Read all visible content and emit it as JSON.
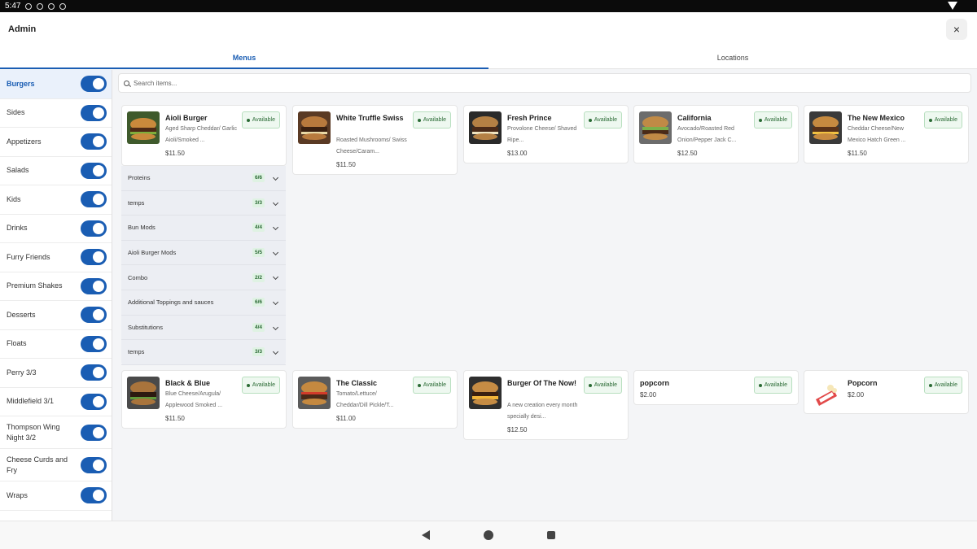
{
  "status": {
    "time": "5:47"
  },
  "app": {
    "title": "Admin",
    "close_label": "×"
  },
  "tabs": [
    {
      "label": "Menus",
      "active": true
    },
    {
      "label": "Locations",
      "active": false
    }
  ],
  "sidebar": {
    "items": [
      {
        "label": "Burgers"
      },
      {
        "label": "Sides"
      },
      {
        "label": "Appetizers"
      },
      {
        "label": "Salads"
      },
      {
        "label": "Kids"
      },
      {
        "label": "Drinks"
      },
      {
        "label": "Furry Friends"
      },
      {
        "label": "Premium Shakes"
      },
      {
        "label": "Desserts"
      },
      {
        "label": "Floats"
      },
      {
        "label": "Perry 3/3"
      },
      {
        "label": "Middlefield 3/1"
      },
      {
        "label": "Thompson Wing Night 3/2"
      },
      {
        "label": "Cheese Curds and Fry"
      },
      {
        "label": "Wraps"
      }
    ]
  },
  "search": {
    "placeholder": "Search items..."
  },
  "badge_label": "Available",
  "items": [
    {
      "name": "Aioli Burger",
      "desc": "Aged Sharp Cheddar/ Garlic Aioli/Smoked ...",
      "price": "$11.50"
    },
    {
      "name": "White Truffle Swiss",
      "desc": "Roasted Mushrooms/ Swiss Cheese/Caram...",
      "price": "$11.50"
    },
    {
      "name": "Fresh Prince",
      "desc": "Provolone Cheese/ Shaved Ripe...",
      "price": "$13.00"
    },
    {
      "name": "California",
      "desc": "Avocado/Roasted Red Onion/Pepper Jack C...",
      "price": "$12.50"
    },
    {
      "name": "The New Mexico",
      "desc": "Cheddar Cheese/New Mexico Hatch Green ...",
      "price": "$11.50"
    },
    {
      "name": "Black & Blue",
      "desc": "Blue Cheese/Arugula/ Applewood Smoked ...",
      "price": "$11.50"
    },
    {
      "name": "The Classic",
      "desc": "Tomato/Lettuce/ Cheddar/Dill Pickle/T...",
      "price": "$11.00"
    },
    {
      "name": "Burger Of The Now!",
      "desc": "A new creation every month specially desi...",
      "price": "$12.50"
    },
    {
      "name": "popcorn",
      "desc": "",
      "price": "$2.00"
    },
    {
      "name": "Popcorn",
      "desc": "",
      "price": "$2.00"
    }
  ],
  "modifier_groups": [
    {
      "name": "Proteins",
      "count": "6/6"
    },
    {
      "name": "temps",
      "count": "3/3"
    },
    {
      "name": "Bun Mods",
      "count": "4/4"
    },
    {
      "name": "Aioli Burger Mods",
      "count": "5/5"
    },
    {
      "name": "Combo",
      "count": "2/2"
    },
    {
      "name": "Additional Toppings and sauces",
      "count": "6/6"
    },
    {
      "name": "Substitutions",
      "count": "4/4"
    },
    {
      "name": "temps",
      "count": "3/3"
    }
  ],
  "colors": {
    "accent": "#1a5db3",
    "available": "#2b6b35"
  }
}
